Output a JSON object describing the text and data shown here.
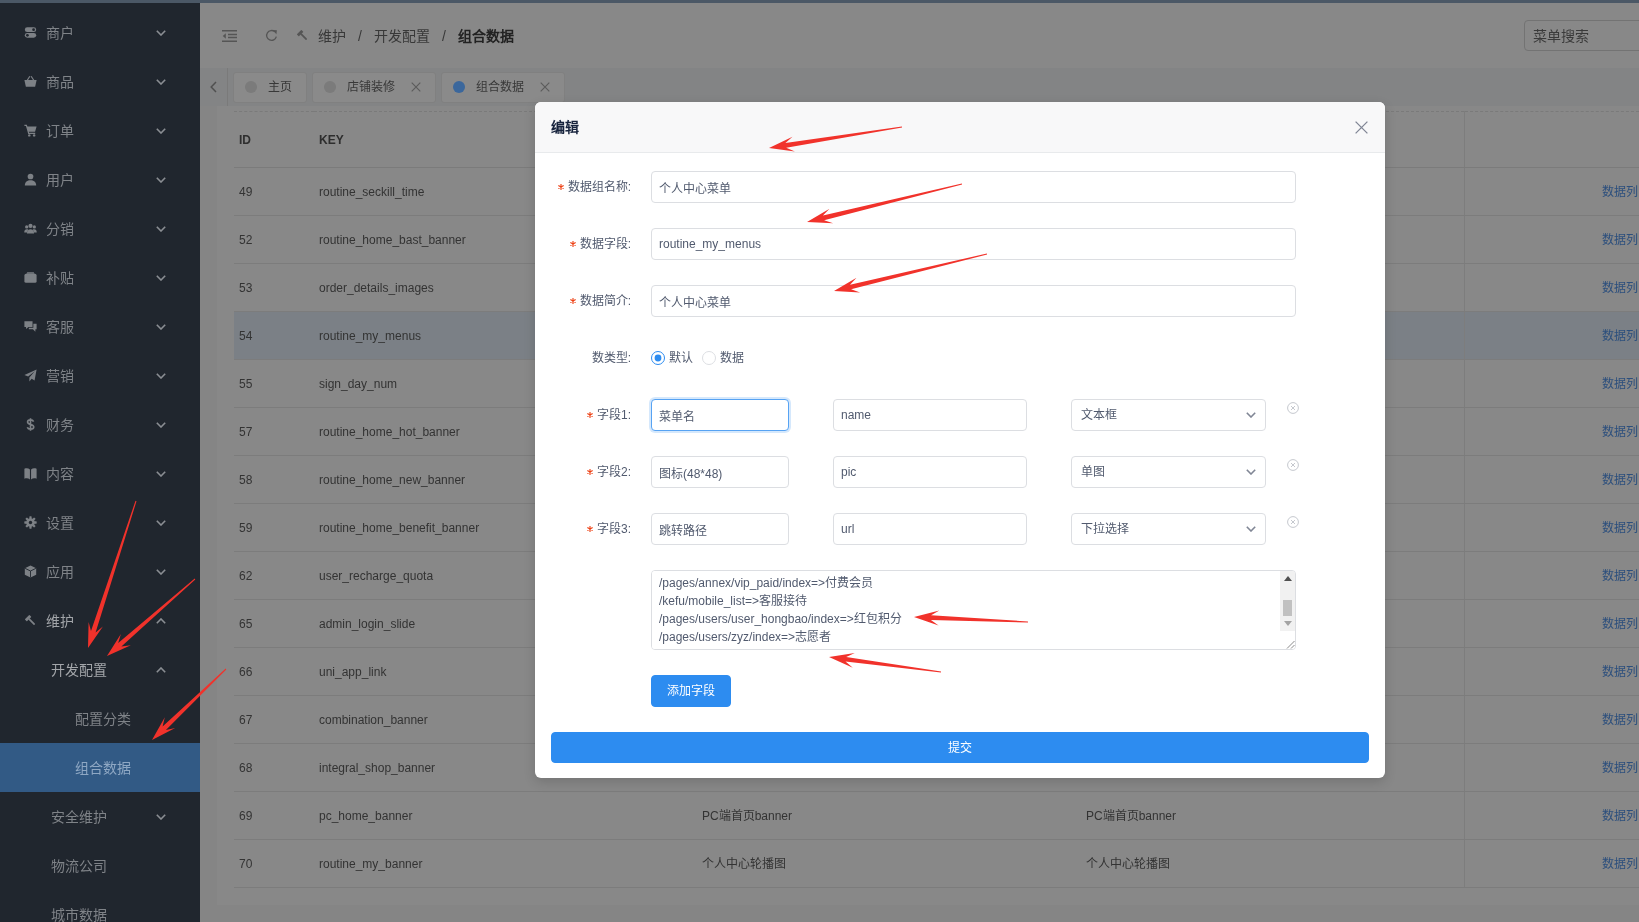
{
  "sidebar": {
    "items": [
      {
        "label": "商户",
        "expanded": false,
        "selected": false
      },
      {
        "label": "商品",
        "expanded": false,
        "selected": false
      },
      {
        "label": "订单",
        "expanded": false,
        "selected": false
      },
      {
        "label": "用户",
        "expanded": false,
        "selected": false
      },
      {
        "label": "分销",
        "expanded": false,
        "selected": false
      },
      {
        "label": "补贴",
        "expanded": false,
        "selected": false
      },
      {
        "label": "客服",
        "expanded": false,
        "selected": false
      },
      {
        "label": "营销",
        "expanded": false,
        "selected": false
      },
      {
        "label": "财务",
        "expanded": false,
        "selected": false
      },
      {
        "label": "内容",
        "expanded": false,
        "selected": false
      },
      {
        "label": "设置",
        "expanded": false,
        "selected": false
      },
      {
        "label": "应用",
        "expanded": false,
        "selected": false
      },
      {
        "label": "维护",
        "expanded": true,
        "selected": false,
        "children": [
          {
            "label": "开发配置",
            "expanded": true,
            "selected": false,
            "children": [
              {
                "label": "配置分类",
                "selected": false
              },
              {
                "label": "组合数据",
                "selected": true
              }
            ]
          },
          {
            "label": "安全维护",
            "expanded": false,
            "selected": false
          },
          {
            "label": "物流公司",
            "selected": false
          },
          {
            "label": "城市数据",
            "selected": false
          }
        ]
      }
    ]
  },
  "header": {
    "breadcrumb": [
      "维护",
      "开发配置",
      "组合数据"
    ],
    "separators": [
      "/",
      "/"
    ],
    "search": {
      "placeholder": "菜单搜索"
    }
  },
  "tabs": [
    {
      "label": "主页",
      "selected": false,
      "closable": false
    },
    {
      "label": "店铺装修",
      "selected": false,
      "closable": true
    },
    {
      "label": "组合数据",
      "selected": true,
      "closable": true
    }
  ],
  "table": {
    "columns": [
      "ID",
      "KEY"
    ],
    "rows": [
      {
        "id": "49",
        "key": "routine_seckill_time",
        "column_5": "数据列",
        "highlighted": false
      },
      {
        "id": "52",
        "key": "routine_home_bast_banner",
        "column_5": "数据列",
        "highlighted": false
      },
      {
        "id": "53",
        "key": "order_details_images",
        "column_5": "数据列",
        "highlighted": false
      },
      {
        "id": "54",
        "key": "routine_my_menus",
        "column_5": "数据列",
        "highlighted": true
      },
      {
        "id": "55",
        "key": "sign_day_num",
        "column_5": "数据列",
        "highlighted": false
      },
      {
        "id": "57",
        "key": "routine_home_hot_banner",
        "column_5": "数据列",
        "highlighted": false
      },
      {
        "id": "58",
        "key": "routine_home_new_banner",
        "column_5": "数据列",
        "highlighted": false
      },
      {
        "id": "59",
        "key": "routine_home_benefit_banner",
        "column_5": "数据列",
        "highlighted": false
      },
      {
        "id": "62",
        "key": "user_recharge_quota",
        "column_5": "数据列",
        "highlighted": false
      },
      {
        "id": "65",
        "key": "admin_login_slide",
        "column_5": "数据列",
        "highlighted": false
      },
      {
        "id": "66",
        "key": "uni_app_link",
        "column_5": "数据列",
        "highlighted": false
      },
      {
        "id": "67",
        "key": "combination_banner",
        "column_5": "数据列",
        "highlighted": false
      },
      {
        "id": "68",
        "key": "integral_shop_banner",
        "column_5": "数据列",
        "highlighted": false
      },
      {
        "id": "69",
        "key": "pc_home_banner",
        "column_3": "PC端首页banner",
        "column_4": "PC端首页banner",
        "column_5": "数据列",
        "highlighted": false
      },
      {
        "id": "70",
        "key": "routine_my_banner",
        "column_3": "个人中心轮播图",
        "column_4": "个人中心轮播图",
        "column_5": "数据列",
        "highlighted": false
      }
    ]
  },
  "modal": {
    "title": "编辑",
    "inputs": [
      {
        "label": "数据组名称:",
        "required": true,
        "value": "个人中心菜单"
      },
      {
        "label": "数据字段:",
        "required": true,
        "value": "routine_my_menus"
      },
      {
        "label": "数据简介:",
        "required": true,
        "value": "个人中心菜单"
      }
    ],
    "type_choice": {
      "label": "数类型:",
      "required": false,
      "options": [
        {
          "label": "默认",
          "selected": true
        },
        {
          "label": "数据",
          "selected": false
        }
      ]
    },
    "field_rows": [
      {
        "label": "字段1:",
        "required": true,
        "title": "菜单名",
        "name": "name",
        "type": "文本框",
        "focused": true
      },
      {
        "label": "字段2:",
        "required": true,
        "title": "图标(48*48)",
        "name": "pic",
        "type": "单图",
        "focused": false
      },
      {
        "label": "字段3:",
        "required": true,
        "title": "跳转路径",
        "name": "url",
        "type": "下拉选择",
        "focused": false
      }
    ],
    "options_text": [
      "/pages/annex/vip_paid/index=>付费会员",
      "/kefu/mobile_list=>客服接待",
      "/pages/users/user_hongbao/index=>红包积分",
      "/pages/users/zyz/index=>志愿者"
    ],
    "add_button": "添加字段",
    "submit_button": "提交"
  }
}
